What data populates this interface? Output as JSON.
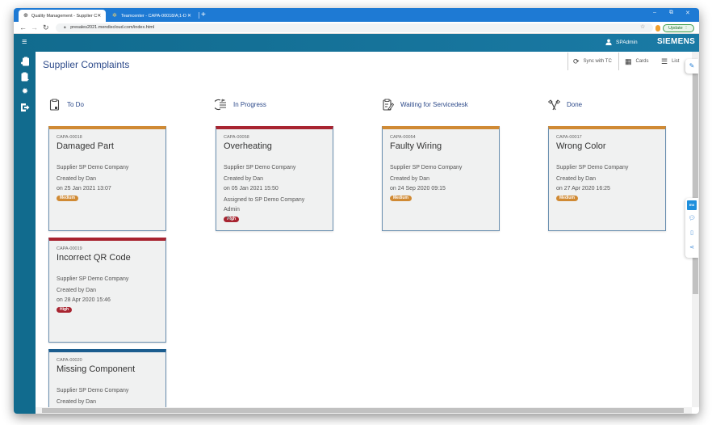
{
  "browser": {
    "tabs": [
      {
        "label": "Quality Management - Supplier C",
        "active": true,
        "icon": "globe-icon"
      },
      {
        "label": "Teamcenter - CAPA-00018/A;1-D",
        "active": false,
        "icon": "teamcenter-icon"
      }
    ],
    "new_tab_label": "+",
    "url": "presales2021.mendixcloud.com/index.html",
    "update_label": "Update",
    "window_controls": {
      "minimize": "–",
      "restore": "⧉",
      "close": "✕"
    }
  },
  "header": {
    "menu_icon": "hamburger-icon",
    "user_name": "SPAdmin",
    "brand": "SIEMENS"
  },
  "sidebar": {
    "items": [
      {
        "name": "complaints",
        "icon": "clipboard-user-icon"
      },
      {
        "name": "tasks",
        "icon": "clipboard-arrow-icon"
      },
      {
        "name": "settings",
        "icon": "gear-icon"
      },
      {
        "name": "logout",
        "icon": "sign-out-icon"
      }
    ]
  },
  "page": {
    "title": "Supplier Complaints",
    "toolbar": {
      "sync_label": "Sync with TC",
      "cards_label": "Cards",
      "list_label": "List"
    }
  },
  "columns": [
    {
      "title": "To Do",
      "icon": "clipboard-icon",
      "cards": [
        {
          "id": "CAPA-00018",
          "title": "Damaged Part",
          "supplier": "Supplier SP Demo Company",
          "created_by": "Created by Dan",
          "created_on": "on 25 Jan 2021 13:07",
          "assigned": "",
          "assigned2": "",
          "priority": "Medium"
        },
        {
          "id": "CAPA-00019",
          "title": "Incorrect QR Code",
          "supplier": "Supplier SP Demo Company",
          "created_by": "Created by Dan",
          "created_on": "on 28 Apr 2020 15:46",
          "assigned": "",
          "assigned2": "",
          "priority": "High"
        },
        {
          "id": "CAPA-00020",
          "title": "Missing Component",
          "supplier": "Supplier SP Demo Company",
          "created_by": "Created by Dan",
          "created_on": "",
          "assigned": "",
          "assigned2": "",
          "priority": ""
        }
      ]
    },
    {
      "title": "In Progress",
      "icon": "progress-list-icon",
      "cards": [
        {
          "id": "CAPA-00058",
          "title": "Overheating",
          "supplier": "Supplier SP Demo Company",
          "created_by": "Created by Dan",
          "created_on": "on 05 Jan 2021 15:50",
          "assigned": "Assigned to SP Demo Company",
          "assigned2": "Admin",
          "priority": "High"
        }
      ]
    },
    {
      "title": "Waiting for Servicedesk",
      "icon": "clipboard-edit-icon",
      "cards": [
        {
          "id": "CAPA-00054",
          "title": "Faulty Wiring",
          "supplier": "Supplier SP Demo Company",
          "created_by": "Created by Dan",
          "created_on": "on 24 Sep 2020 09:15",
          "assigned": "",
          "assigned2": "",
          "priority": "Medium"
        }
      ]
    },
    {
      "title": "Done",
      "icon": "flags-icon",
      "cards": [
        {
          "id": "CAPA-00017",
          "title": "Wrong Color",
          "supplier": "Supplier SP Demo Company",
          "created_by": "Created by Dan",
          "created_on": "on 27 Apr 2020 16:25",
          "assigned": "",
          "assigned2": "",
          "priority": "Medium"
        }
      ]
    }
  ],
  "side_tools": {
    "mx_label": "mx",
    "items": [
      "mendix-icon",
      "feedback-icon",
      "mobile-icon",
      "share-icon"
    ]
  },
  "colors": {
    "header": "#116b8e",
    "title_text": "#2d4a8a",
    "medium": "#d08a34",
    "high": "#a82430",
    "blue_top": "#1b5d8f"
  }
}
